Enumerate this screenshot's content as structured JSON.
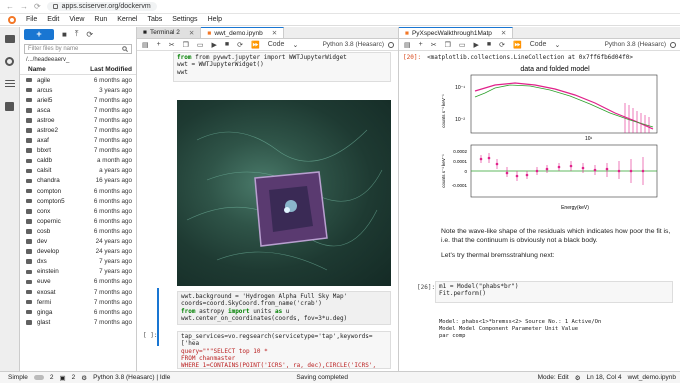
{
  "browser": {
    "url": "apps.sciserver.org/dockervm"
  },
  "menu": [
    "File",
    "Edit",
    "View",
    "Run",
    "Kernel",
    "Tabs",
    "Settings",
    "Help"
  ],
  "filebrowser": {
    "filter_placeholder": "Filter files by name",
    "breadcrumb": "/.../headeeaerv_",
    "col_name": "Name",
    "col_modified": "Last Modified",
    "rows": [
      {
        "name": "agile",
        "date": "6 months ago"
      },
      {
        "name": "arcus",
        "date": "3 years ago"
      },
      {
        "name": "ariel5",
        "date": "7 months ago"
      },
      {
        "name": "asca",
        "date": "7 months ago"
      },
      {
        "name": "astroe",
        "date": "7 months ago"
      },
      {
        "name": "astroe2",
        "date": "7 months ago"
      },
      {
        "name": "axaf",
        "date": "7 months ago"
      },
      {
        "name": "bbxrt",
        "date": "7 months ago"
      },
      {
        "name": "caldb",
        "date": "a month ago"
      },
      {
        "name": "calsit",
        "date": "a years ago"
      },
      {
        "name": "chandra",
        "date": "16 years ago"
      },
      {
        "name": "compton",
        "date": "6 months ago"
      },
      {
        "name": "compton5",
        "date": "6 months ago"
      },
      {
        "name": "conx",
        "date": "6 months ago"
      },
      {
        "name": "copernic",
        "date": "6 months ago"
      },
      {
        "name": "cosb",
        "date": "6 months ago"
      },
      {
        "name": "dev",
        "date": "24 years ago"
      },
      {
        "name": "develop",
        "date": "24 years ago"
      },
      {
        "name": "dxs",
        "date": "7 years ago"
      },
      {
        "name": "einstein",
        "date": "7 years ago"
      },
      {
        "name": "euve",
        "date": "6 months ago"
      },
      {
        "name": "exosat",
        "date": "7 months ago"
      },
      {
        "name": "fermi",
        "date": "7 months ago"
      },
      {
        "name": "ginga",
        "date": "6 months ago"
      },
      {
        "name": "glast",
        "date": "7 months ago"
      }
    ]
  },
  "left_pane": {
    "tabs": [
      {
        "label": "Terminal 2"
      },
      {
        "label": "wwt_demo.ipynb"
      }
    ],
    "celltype": "Code",
    "kernel": "Python 3.8 (Heasarc)",
    "code_top": [
      "from pywwt.jupyter import WWTJupyterWidget",
      "wwt = WWTJupyterWidget()",
      "wwt"
    ],
    "code_mid": [
      "wwt.background = 'Hydrogen Alpha Full Sky Map'",
      "coords=coord.SkyCoord.from_name('crab')",
      "from astropy import units as u",
      "wwt.center_on_coordinates(coords, fov=3*u.deg)"
    ],
    "code_bot": [
      "tap_services=vo.regsearch(servicetype='tap',keywords=['hea",
      "query=\"\"\"SELECT top 10 *",
      "  FROM chanmaster",
      "  WHERE 1=CONTAINS(POINT('ICRS', ra, dec),CIRCLE('ICRS',"
    ],
    "prompt_bot": "[ ]:"
  },
  "right_pane": {
    "tab": "PyXspecWalkthrough1Matp",
    "celltype": "Code",
    "kernel": "Python 3.8 (Heasarc)",
    "out_prompt": "[20]:",
    "out_text": "<matplotlib.collections.LineCollection at 0x7ff6fb6d04f0>",
    "plot_title": "data and folded model",
    "ylabel_top": "counts s⁻¹ keV⁻¹",
    "ylabel_bot": "counts s⁻¹ keV⁻¹",
    "xlabel": "Energy(keV)",
    "yticks_top": [
      "10⁻¹",
      "10⁻²"
    ],
    "yticks_bot": [
      "0.0002",
      "0.0001",
      "0",
      "-0.0001"
    ],
    "xtick": "10¹",
    "md1": "Note the wave-like shape of the residuals which indicates how poor the fit is, i.e. that the continuum is obviously not a black body.",
    "md2": "Let's try thermal bremsstrahlung next:",
    "in_prompt": "[26]:",
    "code": [
      "m1 = Model(\"phabs*br\")",
      "Fit.perform()"
    ],
    "fit_header": [
      "Model: phabs<1>*bremss<2> Source No.: 1  Active/On",
      "Model Model Component  Parameter  Unit  Value",
      "par  comp"
    ]
  },
  "status": {
    "mode": "Simple",
    "count_a": "2",
    "count_b": "2",
    "kernel": "Python 3.8 (Heasarc) | Idle",
    "saving": "Saving completed",
    "edit_mode": "Mode: Edit",
    "position": "Ln 18, Col 4",
    "file": "wwt_demo.ipynb"
  }
}
